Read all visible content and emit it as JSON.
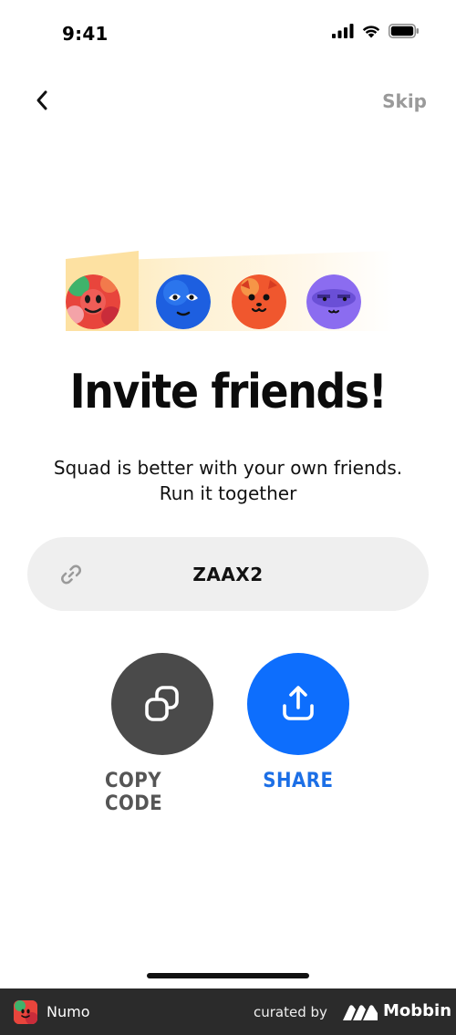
{
  "status_bar": {
    "time": "9:41",
    "icons": [
      "cellular-signal-icon",
      "wifi-icon",
      "battery-icon"
    ]
  },
  "nav": {
    "back_icon": "chevron-left-icon",
    "skip_label": "Skip"
  },
  "hero": {
    "avatars": [
      {
        "name": "red-avatar",
        "color": "#e8453c"
      },
      {
        "name": "blue-avatar",
        "color": "#1d5fe0"
      },
      {
        "name": "orange-avatar",
        "color": "#f0572e"
      },
      {
        "name": "purple-avatar",
        "color": "#8b6cf0"
      }
    ]
  },
  "content": {
    "title": "Invite friends!",
    "subtitle": "Squad is better with your own friends. Run it together"
  },
  "invite_code": {
    "icon": "link-icon",
    "code": "ZAAX2"
  },
  "actions": {
    "copy_label": "COPY CODE",
    "share_label": "SHARE"
  },
  "colors": {
    "accent": "#0d6efd",
    "copy_button": "#4a4a4a",
    "code_field_bg": "#efefef",
    "skip_text": "#9a9a9a"
  },
  "footer": {
    "app_name": "Numo",
    "curated_by": "curated by",
    "brand": "Mobbin"
  }
}
